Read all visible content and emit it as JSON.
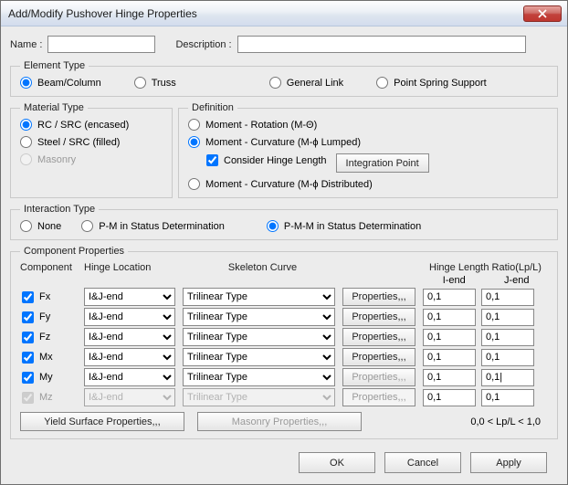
{
  "title": "Add/Modify Pushover Hinge Properties",
  "fields": {
    "name_label": "Name  :",
    "name_value": "",
    "desc_label": "Description  :",
    "desc_value": ""
  },
  "element_type": {
    "legend": "Element Type",
    "options": {
      "beam": "Beam/Column",
      "truss": "Truss",
      "glink": "General Link",
      "spring": "Point Spring Support"
    },
    "selected": "beam"
  },
  "material_type": {
    "legend": "Material Type",
    "options": {
      "rc": "RC / SRC (encased)",
      "steel": "Steel / SRC (filled)",
      "masonry": "Masonry"
    },
    "selected": "rc",
    "masonry_enabled": false
  },
  "definition": {
    "legend": "Definition",
    "options": {
      "mr": "Moment - Rotation (M-Θ)",
      "mcl": "Moment - Curvature (M-ϕ Lumped)",
      "mcd": "Moment - Curvature (M-ϕ Distributed)"
    },
    "selected": "mcl",
    "consider_hinge_label": "Consider Hinge Length",
    "consider_hinge_checked": true,
    "integration_btn": "Integration Point"
  },
  "interaction": {
    "legend": "Interaction Type",
    "options": {
      "none": "None",
      "pm": "P-M in Status Determination",
      "pmm": "P-M-M in Status Determination"
    },
    "selected": "pmm"
  },
  "component": {
    "legend": "Component Properties",
    "headers": {
      "component": "Component",
      "hinge_loc": "Hinge Location",
      "skeleton": "Skeleton Curve",
      "hlr": "Hinge Length Ratio(Lp/L)",
      "iend": "I-end",
      "jend": "J-end",
      "props_btn": "Properties,,,"
    },
    "rows": [
      {
        "name": "Fx",
        "checked": true,
        "enabled": true,
        "hl": "I&J-end",
        "sc": "Trilinear Type",
        "pen": true,
        "i": "0,1",
        "j": "0,1"
      },
      {
        "name": "Fy",
        "checked": true,
        "enabled": true,
        "hl": "I&J-end",
        "sc": "Trilinear Type",
        "pen": true,
        "i": "0,1",
        "j": "0,1"
      },
      {
        "name": "Fz",
        "checked": true,
        "enabled": true,
        "hl": "I&J-end",
        "sc": "Trilinear Type",
        "pen": true,
        "i": "0,1",
        "j": "0,1"
      },
      {
        "name": "Mx",
        "checked": true,
        "enabled": true,
        "hl": "I&J-end",
        "sc": "Trilinear Type",
        "pen": true,
        "i": "0,1",
        "j": "0,1"
      },
      {
        "name": "My",
        "checked": true,
        "enabled": true,
        "hl": "I&J-end",
        "sc": "Trilinear Type",
        "pen": false,
        "i": "0,1",
        "j": "0,1|"
      },
      {
        "name": "Mz",
        "checked": true,
        "enabled": false,
        "hl": "I&J-end",
        "sc": "Trilinear Type",
        "pen": false,
        "i": "0,1",
        "j": "0,1"
      }
    ],
    "yield_btn": "Yield Surface Properties,,,",
    "masonry_btn": "Masonry Properties,,,",
    "hint": "0,0 < Lp/L < 1,0"
  },
  "dialog_buttons": {
    "ok": "OK",
    "cancel": "Cancel",
    "apply": "Apply"
  }
}
